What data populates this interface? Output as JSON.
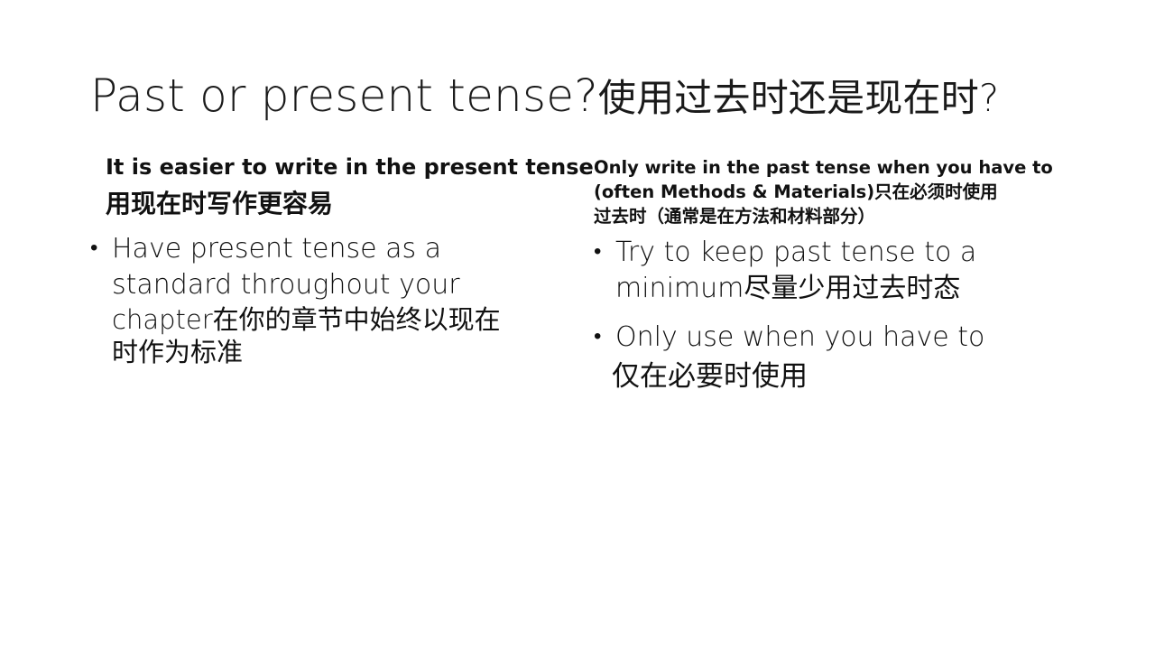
{
  "slide": {
    "title": {
      "en": "Past or present tense?",
      "zh": "使用过去时还是现在时?"
    },
    "left": {
      "heading_en": "It is easier to write in the present tense",
      "heading_zh": "用现在时写作更容易",
      "bullet_1_line_1": "Have present tense as a",
      "bullet_1_line_2": "standard throughout your",
      "bullet_1_line_3": "chapter在你的章节中始终以现在",
      "bullet_1_line_4": "时作为标准"
    },
    "right": {
      "heading_line_1": "Only write in the past tense when you have to",
      "heading_line_2": "(often Methods & Materials)只在必须时使用",
      "heading_line_3": "过去时（通常是在方法和材料部分）",
      "bullet_1_line_1": "Try to keep past tense to a",
      "bullet_1_line_2": "minimum尽量少用过去时态",
      "bullet_2_line_1": "Only use when you have to",
      "bullet_2_line_2": "仅在必要时使用"
    }
  }
}
